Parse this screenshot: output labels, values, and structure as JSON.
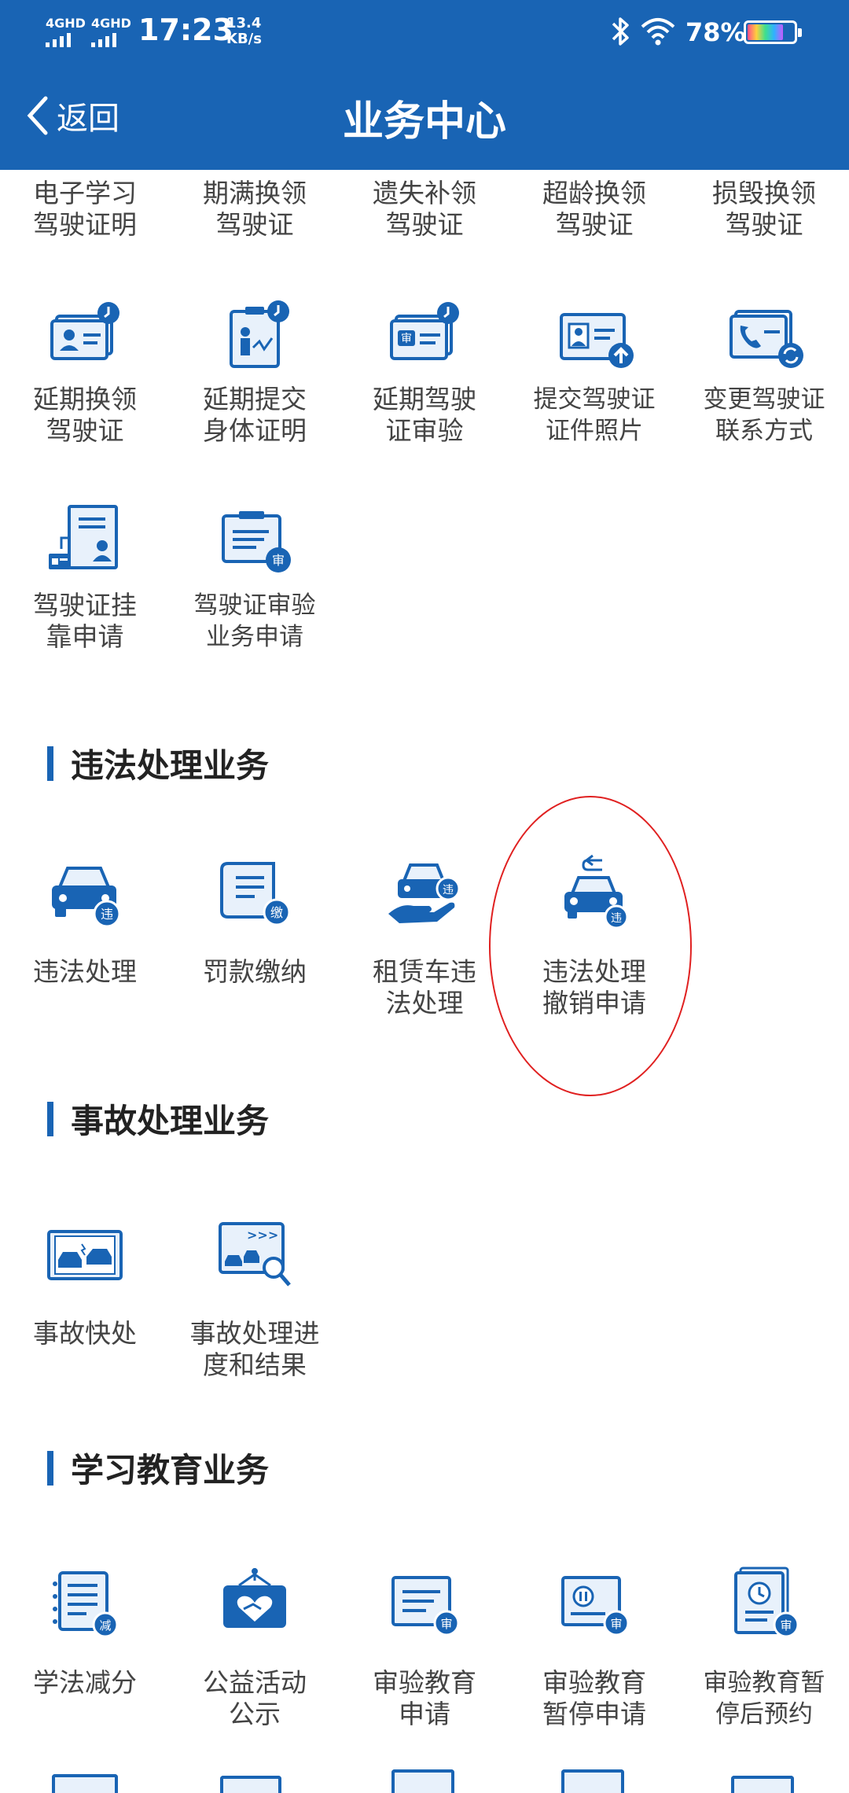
{
  "status_bar": {
    "signal1": "4GHD",
    "signal2": "4GHD",
    "time": "17:23",
    "speed_value": "13.4",
    "speed_unit": "KB/s",
    "battery_pct": "78%",
    "icons": [
      "bluetooth-icon",
      "wifi-icon",
      "battery-icon"
    ]
  },
  "header": {
    "back_label": "返回",
    "title": "业务中心"
  },
  "accent_color": "#1964b4",
  "partial_row": [
    [
      "电子学习",
      "驾驶证明"
    ],
    [
      "期满换领",
      "驾驶证"
    ],
    [
      "遗失补领",
      "驾驶证"
    ],
    [
      "超龄换领",
      "驾驶证"
    ],
    [
      "损毁换领",
      "驾驶证"
    ]
  ],
  "license_services": [
    {
      "l1": "延期换领",
      "l2": "驾驶证",
      "icon": "license-clock-icon"
    },
    {
      "l1": "延期提交",
      "l2": "身体证明",
      "icon": "health-clock-icon"
    },
    {
      "l1": "延期驾驶",
      "l2": "证审验",
      "icon": "review-clock-icon"
    },
    {
      "l1": "提交驾驶证",
      "l2": "证件照片",
      "icon": "photo-upload-icon"
    },
    {
      "l1": "变更驾驶证",
      "l2": "联系方式",
      "icon": "phone-change-icon"
    },
    {
      "l1": "驾驶证挂",
      "l2": "靠申请",
      "icon": "affiliation-icon"
    },
    {
      "l1": "驾驶证审验",
      "l2": "业务申请",
      "icon": "review-apply-icon"
    }
  ],
  "sections": {
    "violation": "违法处理业务",
    "accident": "事故处理业务",
    "education": "学习教育业务"
  },
  "violation_services": [
    {
      "l1": "违法处理",
      "l2": "",
      "icon": "car-violation-icon",
      "badge": "违"
    },
    {
      "l1": "罚款缴纳",
      "l2": "",
      "icon": "fine-payment-icon",
      "badge": "缴"
    },
    {
      "l1": "租赁车违",
      "l2": "法处理",
      "icon": "rental-violation-icon",
      "badge": "违"
    },
    {
      "l1": "违法处理",
      "l2": "撤销申请",
      "icon": "violation-revoke-icon",
      "badge": "违"
    }
  ],
  "accident_services": [
    {
      "l1": "事故快处",
      "l2": "",
      "icon": "accident-quick-icon"
    },
    {
      "l1": "事故处理进",
      "l2": "度和结果",
      "icon": "accident-progress-icon"
    }
  ],
  "education_services": [
    {
      "l1": "学法减分",
      "l2": "",
      "icon": "study-deduct-icon",
      "badge": "减"
    },
    {
      "l1": "公益活动",
      "l2": "公示",
      "icon": "charity-icon"
    },
    {
      "l1": "审验教育",
      "l2": "申请",
      "icon": "review-edu-icon",
      "badge": "审"
    },
    {
      "l1": "审验教育",
      "l2": "暂停申请",
      "icon": "review-pause-icon",
      "badge": "审"
    },
    {
      "l1": "审验教育暂",
      "l2": "停后预约",
      "icon": "review-appointment-icon",
      "badge": "审"
    }
  ]
}
